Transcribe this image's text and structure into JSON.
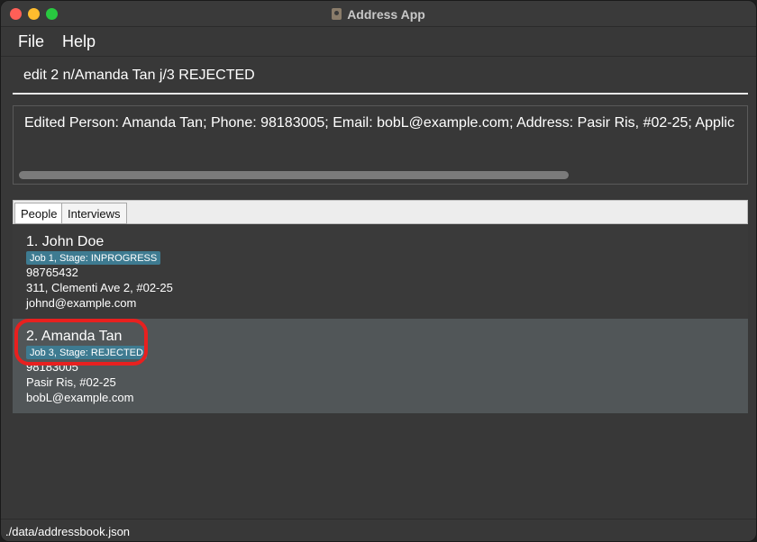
{
  "window": {
    "title": "Address App"
  },
  "menu": {
    "file": "File",
    "help": "Help"
  },
  "command": {
    "value": "edit 2 n/Amanda Tan j/3 REJECTED"
  },
  "result": {
    "text": "Edited Person: Amanda Tan; Phone: 98183005; Email: bobL@example.com; Address: Pasir Ris, #02-25; Applic"
  },
  "tabs": [
    {
      "label": "People",
      "selected": true
    },
    {
      "label": "Interviews",
      "selected": false
    }
  ],
  "people": [
    {
      "name": "1.  John Doe",
      "tag": "Job 1, Stage: INPROGRESS",
      "phone": "98765432",
      "address": "311, Clementi Ave 2, #02-25",
      "email": "johnd@example.com"
    },
    {
      "name": "2.  Amanda Tan",
      "tag": "Job 3, Stage: REJECTED",
      "phone": "98183005",
      "address": "Pasir Ris, #02-25",
      "email": "bobL@example.com"
    }
  ],
  "status": {
    "path": "./data/addressbook.json"
  },
  "colors": {
    "tag_bg": "#3e7b91",
    "selected_row": "#515658",
    "annotation": "#e8201f"
  },
  "icons": {
    "app": "address-book-icon"
  }
}
